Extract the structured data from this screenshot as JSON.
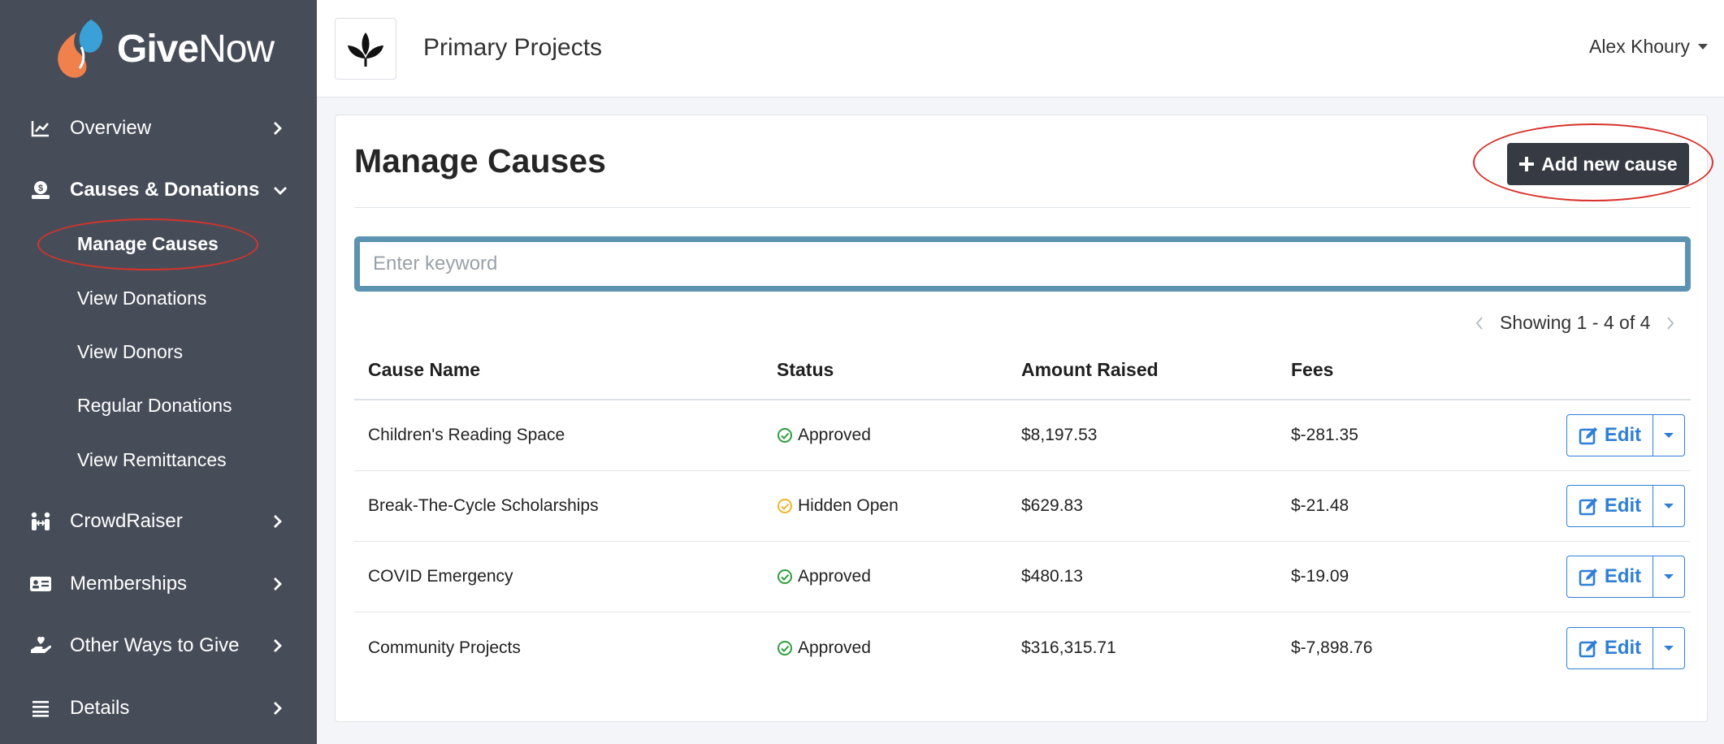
{
  "brand": {
    "name_bold": "Give",
    "name_light": "Now",
    "colors": {
      "drop_orange": "#f0814c",
      "drop_blue": "#3aa0d8"
    }
  },
  "sidebar": {
    "items": [
      {
        "label": "Overview",
        "icon": "chart-line-icon",
        "chevron": "right"
      },
      {
        "label": "Causes & Donations",
        "icon": "donate-icon",
        "chevron": "down",
        "active": true
      },
      {
        "label": "CrowdRaiser",
        "icon": "people-arrows-icon",
        "chevron": "right"
      },
      {
        "label": "Memberships",
        "icon": "id-card-icon",
        "chevron": "right"
      },
      {
        "label": "Other Ways to Give",
        "icon": "hand-holding-heart-icon",
        "chevron": "right"
      },
      {
        "label": "Details",
        "icon": "list-icon",
        "chevron": "right"
      }
    ],
    "subitems": [
      {
        "label": "Manage Causes",
        "active": true
      },
      {
        "label": "View Donations"
      },
      {
        "label": "View Donors"
      },
      {
        "label": "Regular Donations"
      },
      {
        "label": "View Remittances"
      }
    ]
  },
  "header": {
    "org_name": "Primary Projects",
    "org_logo_icon": "leaf-sprout-icon",
    "user_name": "Alex Khoury"
  },
  "main": {
    "title": "Manage Causes",
    "add_button_label": "Add new cause",
    "search_placeholder": "Enter keyword",
    "search_value": "",
    "pagination_text": "Showing 1 - 4 of 4",
    "table": {
      "columns": [
        "Cause Name",
        "Status",
        "Amount Raised",
        "Fees"
      ],
      "rows": [
        {
          "name": "Children's Reading Space",
          "status": "Approved",
          "status_type": "approved",
          "amount": "$8,197.53",
          "fees": "$-281.35",
          "action": "Edit"
        },
        {
          "name": "Break-The-Cycle Scholarships",
          "status": "Hidden Open",
          "status_type": "hidden",
          "amount": "$629.83",
          "fees": "$-21.48",
          "action": "Edit"
        },
        {
          "name": "COVID Emergency",
          "status": "Approved",
          "status_type": "approved",
          "amount": "$480.13",
          "fees": "$-19.09",
          "action": "Edit"
        },
        {
          "name": "Community Projects",
          "status": "Approved",
          "status_type": "approved",
          "amount": "$316,315.71",
          "fees": "$-7,898.76",
          "action": "Edit"
        }
      ]
    }
  },
  "colors": {
    "sidebar_bg": "#474d58",
    "accent_blue": "#2f7fd6",
    "search_border": "#5b93b0",
    "approved_green": "#2e9e3e",
    "hidden_amber": "#f0b429",
    "annotation_red": "#d8322b"
  }
}
